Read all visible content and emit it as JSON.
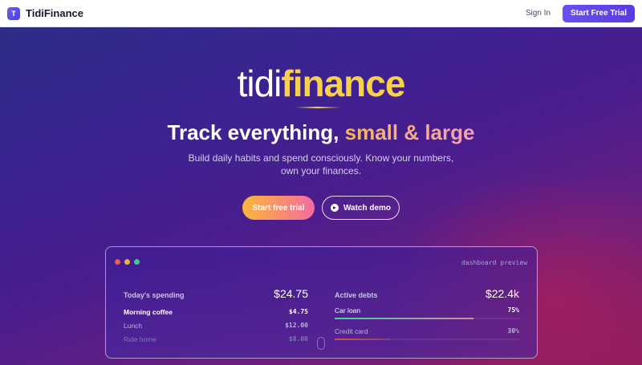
{
  "nav": {
    "logo_letter": "T",
    "brand": "TidiFinance",
    "signin": "Sign In",
    "cta": "Start Free Trial"
  },
  "hero": {
    "wordmark_light": "tidi",
    "wordmark_bold": "finance",
    "tagline_plain": "Track everything,",
    "tagline_accent": "small & large",
    "subtitle": "Build daily habits and spend consciously. Know your numbers, own your finances.",
    "primary_cta": "Start free trial",
    "secondary_cta": "Watch demo"
  },
  "dashboard": {
    "title": "dashboard preview",
    "window_dot_colors": [
      "#ee5a5a",
      "#f2b13b",
      "#3ec98a"
    ],
    "spending": {
      "label": "Today's spending",
      "total": "$24.75",
      "items": [
        {
          "name": "Morning coffee",
          "amount": "$4.75"
        },
        {
          "name": "Lunch",
          "amount": "$12.00"
        },
        {
          "name": "Ride home",
          "amount": "$8.00"
        }
      ]
    },
    "debts": {
      "label": "Active debts",
      "total": "$22.4k",
      "items": [
        {
          "name": "Car loan",
          "percent": "75%",
          "progress": 0.75
        },
        {
          "name": "Credit card",
          "percent": "30%",
          "progress": 0.3
        }
      ]
    }
  },
  "colors": {
    "brand_purple": "#5a3be0",
    "accent_yellow": "#f9d04a",
    "cta_gradient_start": "#fbb63a",
    "cta_gradient_end": "#f46b9f"
  }
}
